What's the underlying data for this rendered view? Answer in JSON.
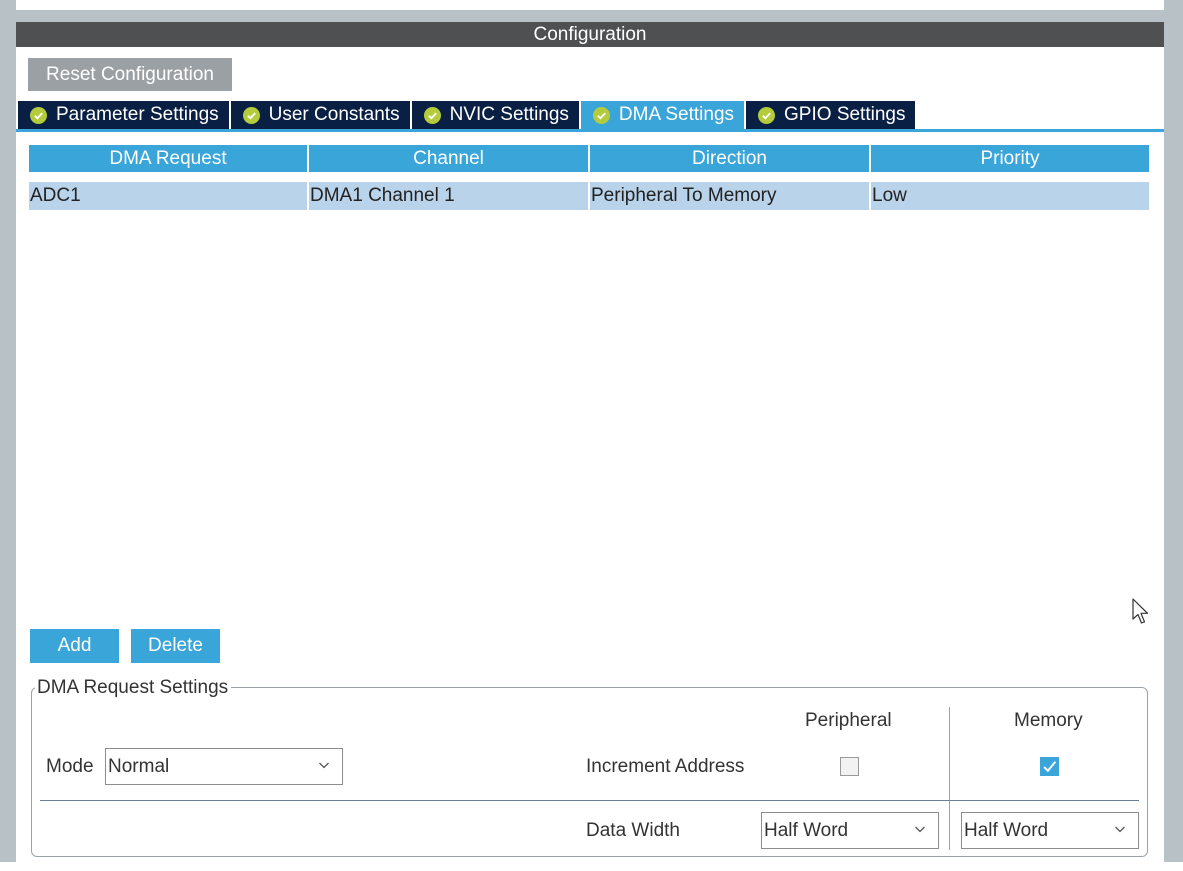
{
  "header": {
    "title": "Configuration"
  },
  "toolbar": {
    "reset_label": "Reset Configuration"
  },
  "tabs": [
    {
      "label": "Parameter Settings",
      "active": false
    },
    {
      "label": "User Constants",
      "active": false
    },
    {
      "label": "NVIC Settings",
      "active": false
    },
    {
      "label": "DMA Settings",
      "active": true
    },
    {
      "label": "GPIO Settings",
      "active": false
    }
  ],
  "table": {
    "columns": [
      "DMA Request",
      "Channel",
      "Direction",
      "Priority"
    ],
    "rows": [
      [
        "ADC1",
        "DMA1 Channel 1",
        "Peripheral To Memory",
        "Low"
      ]
    ]
  },
  "actions": {
    "add_label": "Add",
    "delete_label": "Delete"
  },
  "settings": {
    "legend": "DMA Request Settings",
    "mode_label": "Mode",
    "mode_value": "Normal",
    "peripheral_header": "Peripheral",
    "memory_header": "Memory",
    "increment_label": "Increment Address",
    "peripheral_increment": false,
    "memory_increment": true,
    "data_width_label": "Data Width",
    "peripheral_width": "Half Word",
    "memory_width": "Half Word"
  },
  "icons": {
    "tab_status": "check-circle-icon",
    "dropdown": "chevron-down-icon",
    "cursor": "mouse-pointer-icon"
  },
  "colors": {
    "accent": "#3aa5d8",
    "tab_bg": "#0a1f44",
    "header_bg": "#4f5051",
    "check_green": "#b4cc3c",
    "row_selected": "#b9d3ea"
  }
}
